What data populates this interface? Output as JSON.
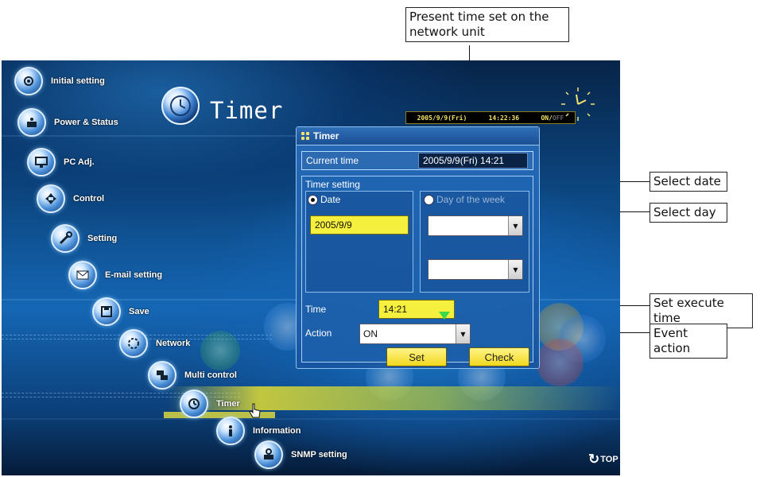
{
  "callouts": {
    "present_time": "Present time set on the network unit",
    "select_date": "Select date",
    "select_day": "Select day",
    "set_execute_time": "Set execute time",
    "event_action": "Event action"
  },
  "menu": {
    "items": [
      {
        "label": "Initial setting",
        "icon": "gear-icon"
      },
      {
        "label": "Power & Status",
        "icon": "power-icon"
      },
      {
        "label": "PC Adj.",
        "icon": "monitor-icon"
      },
      {
        "label": "Control",
        "icon": "control-icon"
      },
      {
        "label": "Setting",
        "icon": "wrench-icon"
      },
      {
        "label": "E-mail setting",
        "icon": "envelope-icon"
      },
      {
        "label": "Save",
        "icon": "save-icon"
      },
      {
        "label": "Network",
        "icon": "network-icon"
      },
      {
        "label": "Multi control",
        "icon": "multi-control-icon"
      },
      {
        "label": "Timer",
        "icon": "clock-icon"
      },
      {
        "label": "Information",
        "icon": "info-icon"
      },
      {
        "label": "SNMP setting",
        "icon": "snmp-icon"
      }
    ]
  },
  "header": {
    "title": "Timer",
    "status_date": "2005/9/9(Fri)",
    "status_time": "14:22:36",
    "status_on": "ON/",
    "status_off": "OFF"
  },
  "timer_panel": {
    "title": "Timer",
    "current_time_label": "Current time",
    "current_time_value": "2005/9/9(Fri) 14:21",
    "timer_setting_label": "Timer setting",
    "date_radio_label": "Date",
    "date_value": "2005/9/9",
    "day_radio_label": "Day of the week",
    "day_select_value": "",
    "day_select2_value": "",
    "time_label": "Time",
    "time_value": "14:21",
    "action_label": "Action",
    "action_value": "ON",
    "set_button": "Set",
    "check_button": "Check",
    "selected_mode": "Date"
  },
  "footer": {
    "top_link": "TOP"
  },
  "colors": {
    "accent_yellow": "#f5ef3d",
    "panel_blue": "#2c6ab2",
    "background_dark": "#072448"
  }
}
